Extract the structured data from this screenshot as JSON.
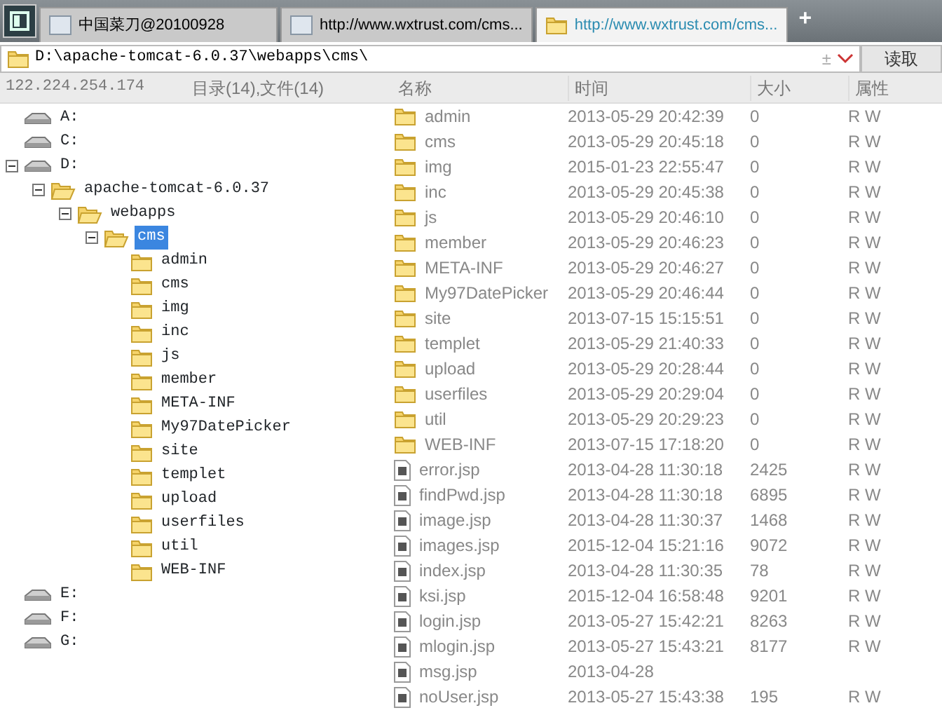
{
  "tabs": [
    {
      "label": "中国菜刀@20100928",
      "kind": "page",
      "selected": false
    },
    {
      "label": "http://www.wxtrust.com/cms...",
      "kind": "page",
      "selected": false
    },
    {
      "label": "http://www.wxtrust.com/cms...",
      "kind": "folder",
      "selected": true
    }
  ],
  "new_tab": "+",
  "address": {
    "value": "D:\\apache-tomcat-6.0.37\\webapps\\cms\\",
    "plusminus": "±",
    "button": "读取"
  },
  "info": {
    "ip": "122.224.254.174",
    "counts": "目录(14),文件(14)"
  },
  "columns": [
    "名称",
    "时间",
    "大小",
    "属性"
  ],
  "tree": [
    {
      "label": "A:",
      "kind": "drive"
    },
    {
      "label": "C:",
      "kind": "drive"
    },
    {
      "label": "D:",
      "kind": "drive",
      "expanded": true,
      "children": [
        {
          "label": "apache-tomcat-6.0.37",
          "kind": "folder",
          "expanded": true,
          "children": [
            {
              "label": "webapps",
              "kind": "folder",
              "expanded": true,
              "children": [
                {
                  "label": "cms",
                  "kind": "folder",
                  "expanded": true,
                  "selected": true,
                  "children": [
                    {
                      "label": "admin",
                      "kind": "folder"
                    },
                    {
                      "label": "cms",
                      "kind": "folder"
                    },
                    {
                      "label": "img",
                      "kind": "folder"
                    },
                    {
                      "label": "inc",
                      "kind": "folder"
                    },
                    {
                      "label": "js",
                      "kind": "folder"
                    },
                    {
                      "label": "member",
                      "kind": "folder"
                    },
                    {
                      "label": "META-INF",
                      "kind": "folder"
                    },
                    {
                      "label": "My97DatePicker",
                      "kind": "folder"
                    },
                    {
                      "label": "site",
                      "kind": "folder"
                    },
                    {
                      "label": "templet",
                      "kind": "folder"
                    },
                    {
                      "label": "upload",
                      "kind": "folder"
                    },
                    {
                      "label": "userfiles",
                      "kind": "folder"
                    },
                    {
                      "label": "util",
                      "kind": "folder"
                    },
                    {
                      "label": "WEB-INF",
                      "kind": "folder"
                    }
                  ]
                }
              ]
            }
          ]
        }
      ]
    },
    {
      "label": "E:",
      "kind": "drive"
    },
    {
      "label": "F:",
      "kind": "drive"
    },
    {
      "label": "G:",
      "kind": "drive"
    }
  ],
  "files": [
    {
      "name": "admin",
      "kind": "folder",
      "time": "2013-05-29 20:42:39",
      "size": "0",
      "attr": "R W"
    },
    {
      "name": "cms",
      "kind": "folder",
      "time": "2013-05-29 20:45:18",
      "size": "0",
      "attr": "R W"
    },
    {
      "name": "img",
      "kind": "folder",
      "time": "2015-01-23 22:55:47",
      "size": "0",
      "attr": "R W"
    },
    {
      "name": "inc",
      "kind": "folder",
      "time": "2013-05-29 20:45:38",
      "size": "0",
      "attr": "R W"
    },
    {
      "name": "js",
      "kind": "folder",
      "time": "2013-05-29 20:46:10",
      "size": "0",
      "attr": "R W"
    },
    {
      "name": "member",
      "kind": "folder",
      "time": "2013-05-29 20:46:23",
      "size": "0",
      "attr": "R W"
    },
    {
      "name": "META-INF",
      "kind": "folder",
      "time": "2013-05-29 20:46:27",
      "size": "0",
      "attr": "R W"
    },
    {
      "name": "My97DatePicker",
      "kind": "folder",
      "time": "2013-05-29 20:46:44",
      "size": "0",
      "attr": "R W"
    },
    {
      "name": "site",
      "kind": "folder",
      "time": "2013-07-15 15:15:51",
      "size": "0",
      "attr": "R W"
    },
    {
      "name": "templet",
      "kind": "folder",
      "time": "2013-05-29 21:40:33",
      "size": "0",
      "attr": "R W"
    },
    {
      "name": "upload",
      "kind": "folder",
      "time": "2013-05-29 20:28:44",
      "size": "0",
      "attr": "R W"
    },
    {
      "name": "userfiles",
      "kind": "folder",
      "time": "2013-05-29 20:29:04",
      "size": "0",
      "attr": "R W"
    },
    {
      "name": "util",
      "kind": "folder",
      "time": "2013-05-29 20:29:23",
      "size": "0",
      "attr": "R W"
    },
    {
      "name": "WEB-INF",
      "kind": "folder",
      "time": "2013-07-15 17:18:20",
      "size": "0",
      "attr": "R W"
    },
    {
      "name": "error.jsp",
      "kind": "file",
      "time": "2013-04-28 11:30:18",
      "size": "2425",
      "attr": "R W"
    },
    {
      "name": "findPwd.jsp",
      "kind": "file",
      "time": "2013-04-28 11:30:18",
      "size": "6895",
      "attr": "R W"
    },
    {
      "name": "image.jsp",
      "kind": "file",
      "time": "2013-04-28 11:30:37",
      "size": "1468",
      "attr": "R W"
    },
    {
      "name": "images.jsp",
      "kind": "file",
      "time": "2015-12-04 15:21:16",
      "size": "9072",
      "attr": "R W"
    },
    {
      "name": "index.jsp",
      "kind": "file",
      "time": "2013-04-28 11:30:35",
      "size": "78",
      "attr": "R W"
    },
    {
      "name": "ksi.jsp",
      "kind": "file",
      "time": "2015-12-04 16:58:48",
      "size": "9201",
      "attr": "R W"
    },
    {
      "name": "login.jsp",
      "kind": "file",
      "time": "2013-05-27 15:42:21",
      "size": "8263",
      "attr": "R W"
    },
    {
      "name": "mlogin.jsp",
      "kind": "file",
      "time": "2013-05-27 15:43:21",
      "size": "8177",
      "attr": "R W"
    },
    {
      "name": "msg.jsp",
      "kind": "file",
      "time": "2013-04-28"
    },
    {
      "name": "noUser.jsp",
      "kind": "file",
      "time": "2013-05-27 15:43:38",
      "size": "195",
      "attr": "R W"
    }
  ]
}
